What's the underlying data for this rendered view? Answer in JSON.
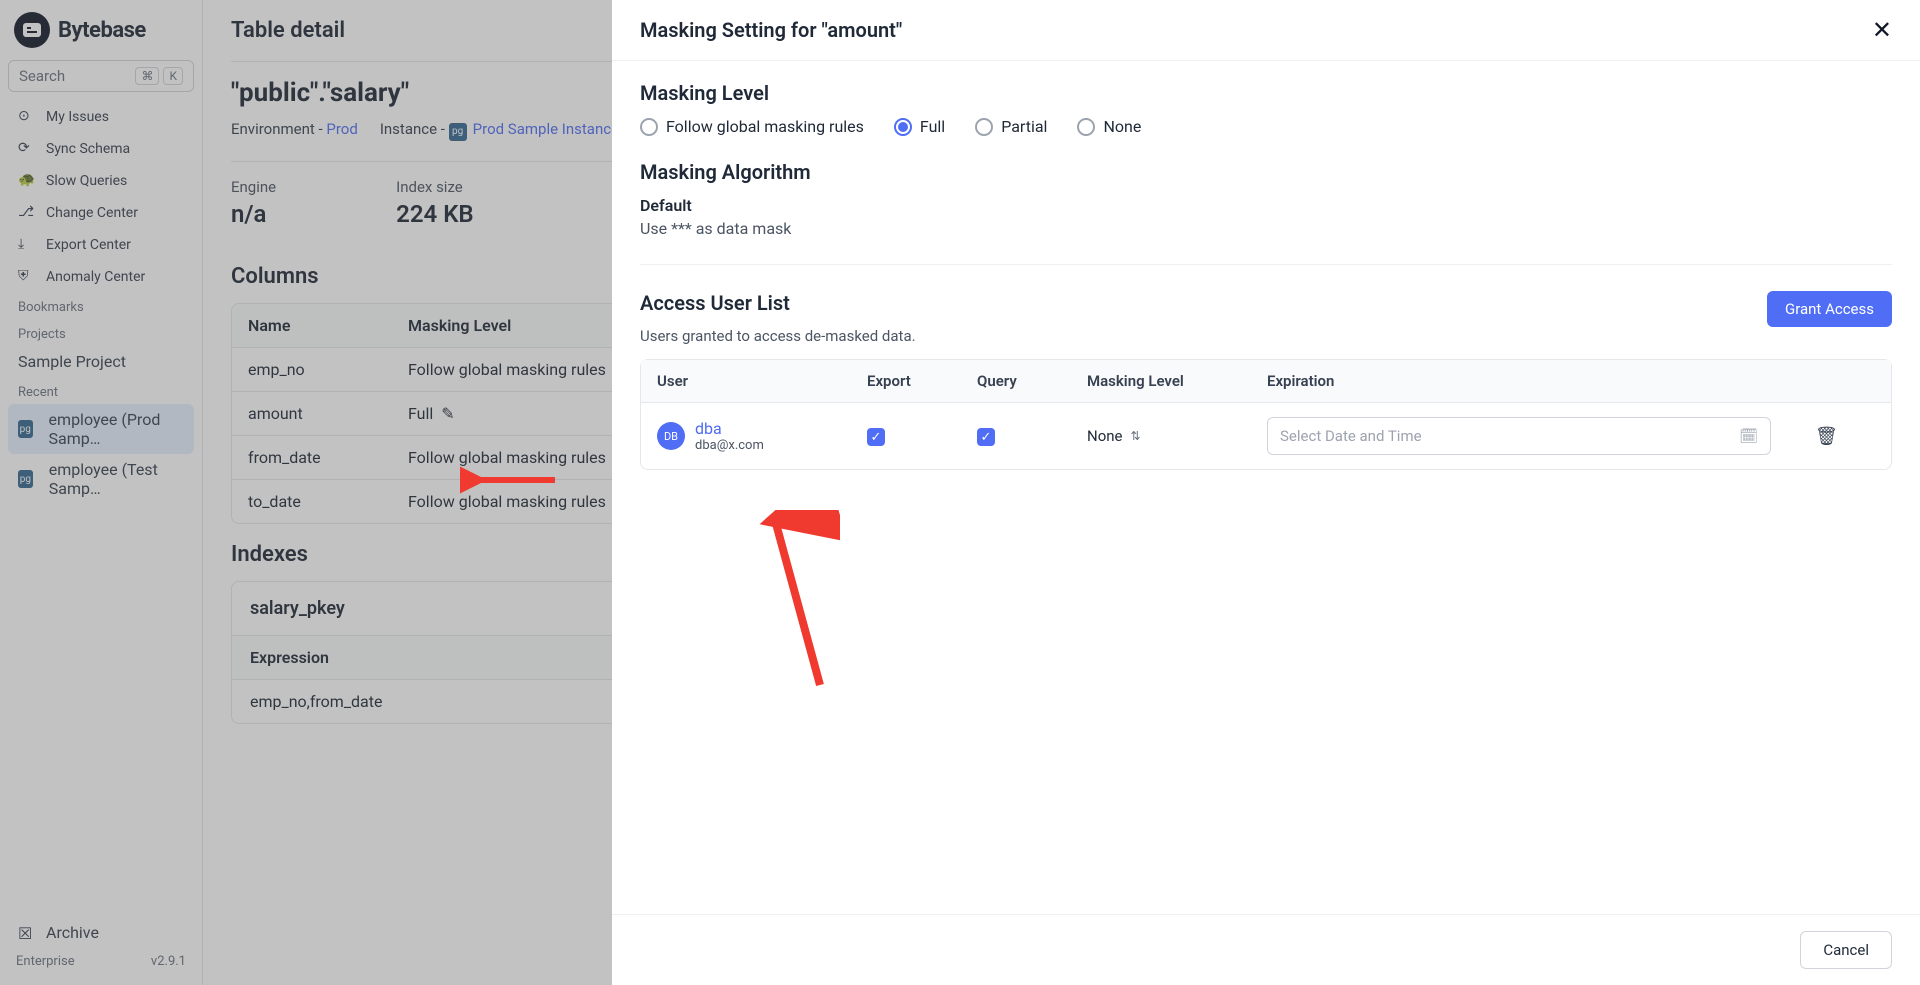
{
  "brand": "Bytebase",
  "search": {
    "placeholder": "Search",
    "kbd1": "⌘",
    "kbd2": "K"
  },
  "nav": {
    "items": [
      "My Issues",
      "Sync Schema",
      "Slow Queries",
      "Change Center",
      "Export Center",
      "Anomaly Center"
    ],
    "bookmarks_label": "Bookmarks",
    "projects_label": "Projects",
    "project": "Sample Project",
    "recent_label": "Recent",
    "recent": [
      "employee (Prod Samp…",
      "employee (Test Samp…"
    ],
    "archive": "Archive"
  },
  "version": {
    "left": "Enterprise",
    "right": "v2.9.1"
  },
  "page": {
    "title": "Table detail",
    "fqn": "\"public\".\"salary\"",
    "env_label": "Environment - ",
    "env_value": "Prod",
    "inst_label": "Instance - ",
    "inst_value": "Prod Sample Instance",
    "engine_label": "Engine",
    "engine_value": "n/a",
    "index_size_label": "Index size",
    "index_size_value": "224 KB",
    "columns_title": "Columns",
    "col_headers": {
      "name": "Name",
      "mask": "Masking Level"
    },
    "rows": [
      {
        "name": "emp_no",
        "mask": "Follow global masking rules"
      },
      {
        "name": "amount",
        "mask": "Full"
      },
      {
        "name": "from_date",
        "mask": "Follow global masking rules"
      },
      {
        "name": "to_date",
        "mask": "Follow global masking rules"
      }
    ],
    "indexes_title": "Indexes",
    "index_name": "salary_pkey",
    "expr_label": "Expression",
    "expr_value": "emp_no,from_date"
  },
  "drawer": {
    "title": "Masking Setting for \"amount\"",
    "level_title": "Masking Level",
    "options": {
      "follow": "Follow global masking rules",
      "full": "Full",
      "partial": "Partial",
      "none": "None"
    },
    "selected": "full",
    "algo_title": "Masking Algorithm",
    "algo_default": "Default",
    "algo_desc": "Use *** as data mask",
    "access_title": "Access User List",
    "access_sub": "Users granted to access de-masked data.",
    "grant_btn": "Grant Access",
    "headers": {
      "user": "User",
      "export": "Export",
      "query": "Query",
      "mask": "Masking Level",
      "exp": "Expiration"
    },
    "user": {
      "initials": "DB",
      "name": "dba",
      "email": "dba@x.com",
      "level": "None",
      "date_placeholder": "Select Date and Time"
    },
    "cancel": "Cancel"
  }
}
